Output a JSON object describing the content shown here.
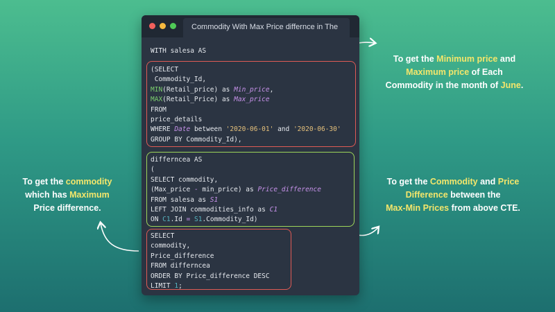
{
  "window": {
    "tab_title": "Commodity With Max Price differnce in The"
  },
  "code": {
    "line1": "WITH salesa AS",
    "block1": {
      "l1": "(SELECT",
      "l2": " Commodity_Id,",
      "l3_fn": "MIN",
      "l3_rest": "(Retail_price) as ",
      "l3_alias": "Min_price",
      "l3_end": ",",
      "l4_fn": "MAX",
      "l4_rest": "(Retail_Price) as ",
      "l4_alias": "Max_price",
      "l5": "FROM",
      "l6": "price_details",
      "l7_a": "WHERE ",
      "l7_date": "Date",
      "l7_b": " between ",
      "l7_s1": "'2020-06-01'",
      "l7_c": " and ",
      "l7_s2": "'2020-06-30'",
      "l8": "GROUP BY Commodity_Id),"
    },
    "block2": {
      "l1": "differncea AS",
      "l2": "(",
      "l3": "SELECT commodity,",
      "l4_a": "(Max_price ",
      "l4_op": "-",
      "l4_b": " min_price) as ",
      "l4_alias": "Price_difference",
      "l5_a": "FROM salesa as ",
      "l5_alias": "S1",
      "l6_a": "LEFT JOIN commodities_info as ",
      "l6_alias": "C1",
      "l7_a": "ON ",
      "l7_c1": "C1",
      "l7_b": ".Id ",
      "l7_eq": "=",
      "l7_c": " ",
      "l7_s1": "S1",
      "l7_d": ".Commodity_Id)"
    },
    "block3": {
      "l1": "SELECT",
      "l2": "commodity,",
      "l3": "Price_difference",
      "l4": "FROM differncea",
      "l5": "ORDER BY Price_difference DESC",
      "l6_a": "LIMIT ",
      "l6_num": "1",
      "l6_b": ";"
    }
  },
  "notes": {
    "top_right": {
      "p1": "To get the ",
      "h1": "Minimum price",
      "p2": " and",
      "h2": "Maximum price",
      "p3": " of Each",
      "p4": "Commodity in the month of ",
      "h3": "June",
      "p5": "."
    },
    "mid_right": {
      "p1": "To get the ",
      "h1": "Commodity",
      "p2": " and  ",
      "h2": "Price",
      "h3": "Difference",
      "p3": " between the",
      "h4": "Max-Min Prices",
      "p4": " from above CTE."
    },
    "left": {
      "p1": "To get the ",
      "h1": "commodity",
      "p2": "which has ",
      "h2": "Maximum",
      "p3": "Price difference."
    }
  },
  "colors": {
    "highlight": "#f4e66b",
    "box_red": "#e05b55",
    "box_green": "#9ed65a",
    "window_bg": "#2b3442"
  }
}
